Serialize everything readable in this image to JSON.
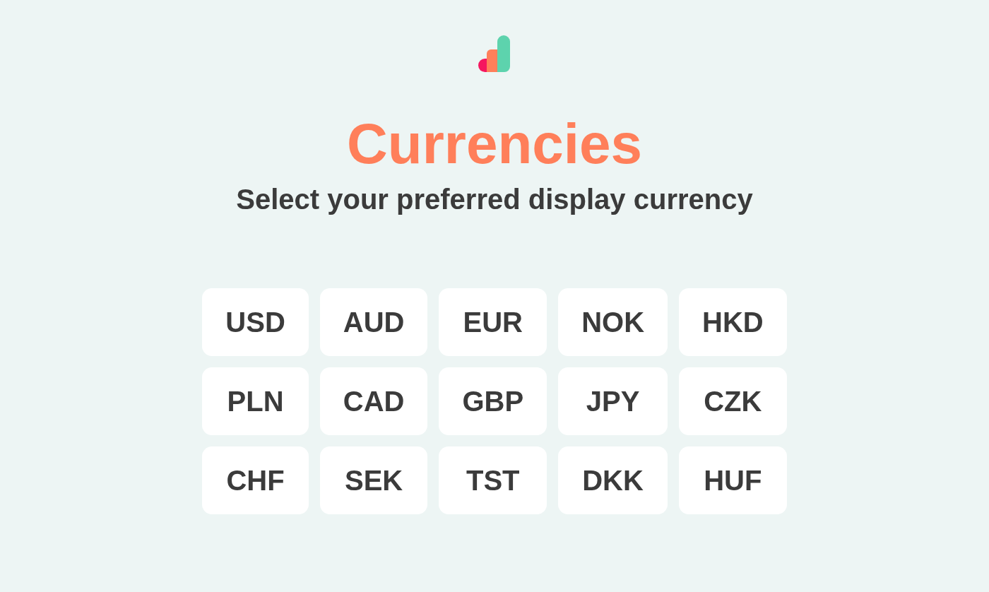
{
  "header": {
    "title": "Currencies",
    "subtitle": "Select your preferred display currency"
  },
  "currencies": [
    {
      "code": "USD"
    },
    {
      "code": "AUD"
    },
    {
      "code": "EUR"
    },
    {
      "code": "NOK"
    },
    {
      "code": "HKD"
    },
    {
      "code": "PLN"
    },
    {
      "code": "CAD"
    },
    {
      "code": "GBP"
    },
    {
      "code": "JPY"
    },
    {
      "code": "CZK"
    },
    {
      "code": "CHF"
    },
    {
      "code": "SEK"
    },
    {
      "code": "TST"
    },
    {
      "code": "DKK"
    },
    {
      "code": "HUF"
    }
  ]
}
